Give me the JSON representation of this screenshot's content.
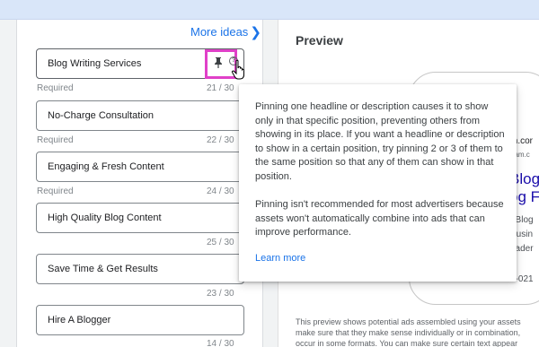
{
  "more_ideas": {
    "label": "More ideas"
  },
  "fields": [
    {
      "value": "Blog Writing Services",
      "helper": "Required",
      "count": "21 / 30"
    },
    {
      "value": "No-Charge Consultation",
      "helper": "Required",
      "count": "22 / 30"
    },
    {
      "value": "Engaging & Fresh Content",
      "helper": "Required",
      "count": "24 / 30"
    },
    {
      "value": "High Quality Blog Content",
      "helper": "",
      "count": "25 / 30"
    },
    {
      "value": "Save Time & Get Results",
      "helper": "",
      "count": "23 / 30"
    },
    {
      "value": "Hire A Blogger",
      "helper": "",
      "count": "14 / 30"
    }
  ],
  "preview": {
    "title": "Preview",
    "url_partial": "m.cor",
    "url_partial2": "eam.c",
    "headline_partial1": "Blog",
    "headline_partial2": "og F",
    "desc_partial1": "t Blog",
    "desc_partial2": "Busin",
    "desc_partial3": "eader",
    "phone_partial": "6-021",
    "note_line1": "This preview shows potential ads assembled using your assets",
    "note_line2": "make sure that they make sense individually or in combination,",
    "note_line3": "occur in some formats. You can make sure certain text appear"
  },
  "tooltip": {
    "para1": "Pinning one headline or description causes it to show only in that specific position, preventing others from showing in its place. If you want a headline or description to show in a certain position, try pinning 2 or 3 of them to the same position so that any of them can show in that position.",
    "para2": "Pinning isn't recommended for most advertisers because assets won't automatically combine into ads that can improve performance.",
    "link": "Learn more"
  },
  "colors": {
    "accent": "#1a73e8",
    "highlight": "#e040c8",
    "top_band": "#d9e6f9"
  }
}
